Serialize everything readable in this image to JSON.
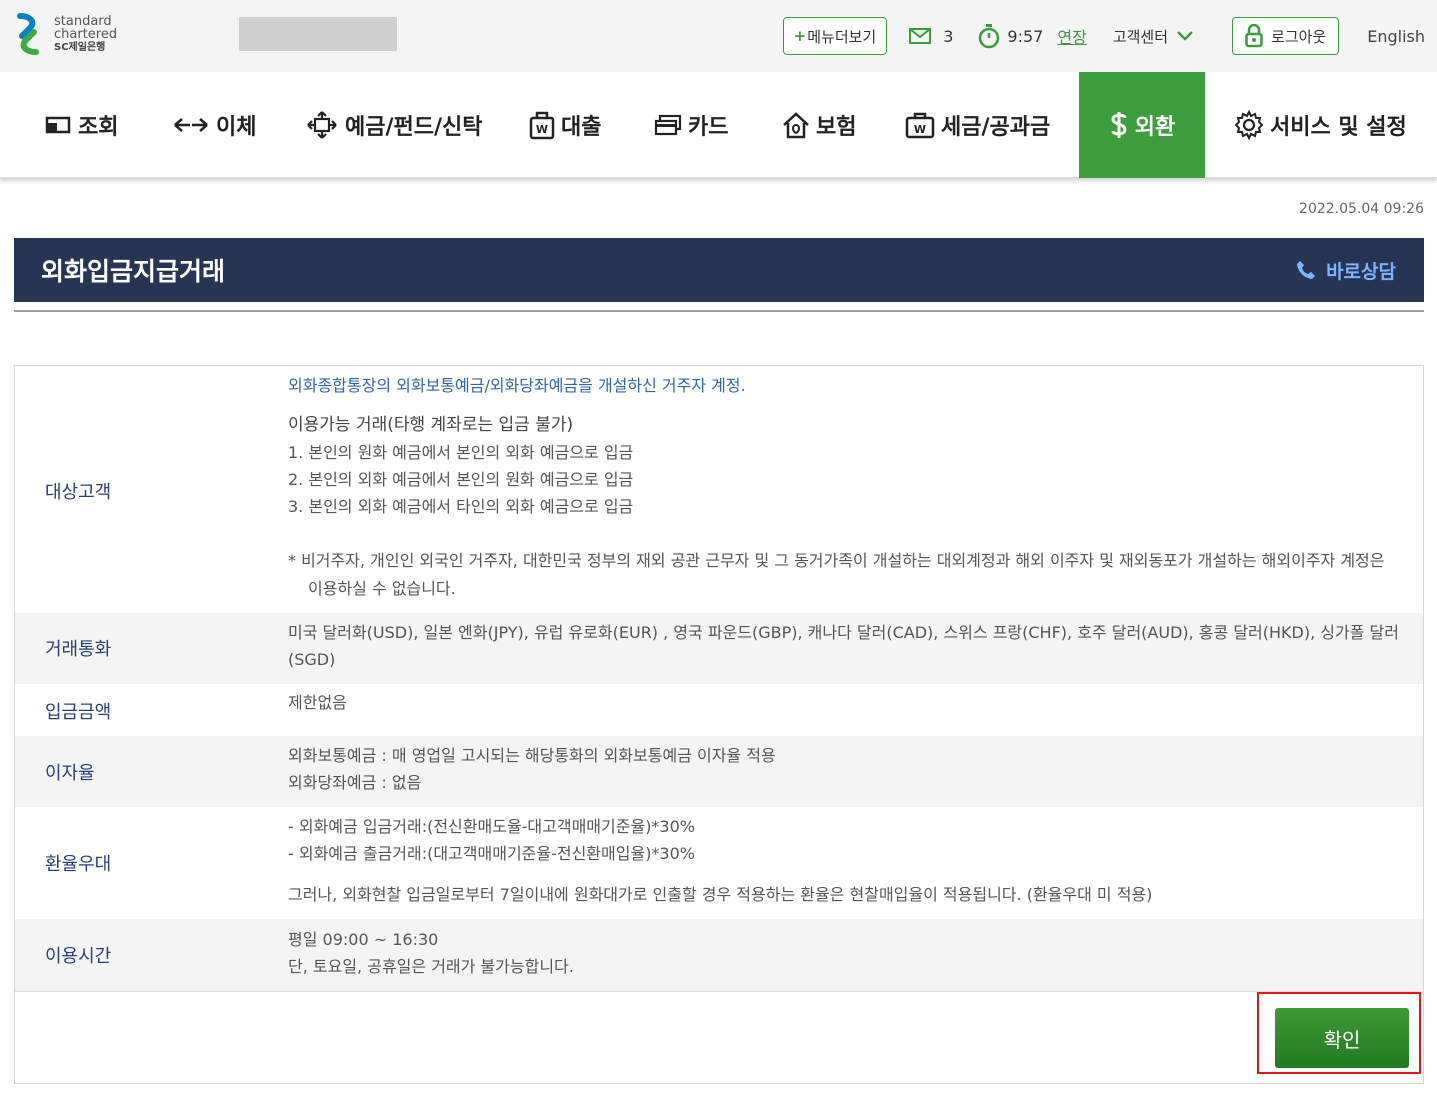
{
  "header": {
    "logo_line1": "standard",
    "logo_line2": "chartered",
    "logo_line3": "SC제일은행",
    "menu_plus": "+",
    "menu_label": "메뉴더보기",
    "mail_count": "3",
    "timer": "9:57",
    "extend_label": "연장",
    "customer_center": "고객센터",
    "logout_label": "로그아웃",
    "language": "English"
  },
  "nav": {
    "items": [
      {
        "label": "조회",
        "icon": "inquiry-icon"
      },
      {
        "label": "이체",
        "icon": "transfer-icon"
      },
      {
        "label": "예금/펀드/신탁",
        "icon": "deposit-icon"
      },
      {
        "label": "대출",
        "icon": "loan-icon"
      },
      {
        "label": "카드",
        "icon": "card-icon"
      },
      {
        "label": "보험",
        "icon": "insurance-icon"
      },
      {
        "label": "세금/공과금",
        "icon": "tax-icon"
      },
      {
        "label": "외환",
        "icon": "dollar-icon",
        "active": true
      },
      {
        "label": "서비스 및 설정",
        "icon": "gear-icon"
      }
    ]
  },
  "datetime": "2022.05.04 09:26",
  "page": {
    "title": "외화입금지급거래",
    "consult_label": "바로상담"
  },
  "info": {
    "target": {
      "label": "대상고객",
      "line1": "외화종합통장의 외화보통예금/외화당좌예금을 개설하신 거주자 계정.",
      "subtitle": "이용가능 거래(타행 계좌로는 입금 불가)",
      "item1": "1. 본인의 원화 예금에서 본인의 외화 예금으로 입금",
      "item2": "2. 본인의 외화 예금에서 본인의 원화 예금으로 입금",
      "item3": "3. 본인의 외화 예금에서 타인의 외화 예금으로 입금",
      "note": "* 비거주자, 개인인 외국인 거주자, 대한민국 정부의 재외 공관 근무자 및 그 동거가족이 개설하는 대외계정과 해외 이주자 및 재외동포가 개설하는 해외이주자 계정은 이용하실 수 없습니다."
    },
    "currency": {
      "label": "거래통화",
      "text": "미국 달러화(USD), 일본 엔화(JPY), 유럽 유로화(EUR) , 영국 파운드(GBP), 캐나다 달러(CAD), 스위스 프랑(CHF), 호주 달러(AUD), 홍콩 달러(HKD), 싱가폴 달러(SGD)"
    },
    "amount": {
      "label": "입금금액",
      "text": "제한없음"
    },
    "interest": {
      "label": "이자율",
      "line1": "외화보통예금 : 매 영업일 고시되는 해당통화의 외화보통예금 이자율 적용",
      "line2": "외화당좌예금 : 없음"
    },
    "fx": {
      "label": "환율우대",
      "line1": "- 외화예금 입금거래:(전신환매도율-대고객매매기준율)*30%",
      "line2": "- 외화예금 출금거래:(대고객매매기준율-전신환매입율)*30%",
      "line3": "그러나, 외화현찰 입금일로부터 7일이내에 원화대가로 인출할 경우 적용하는 환율은 현찰매입율이 적용됩니다. (환율우대 미 적용)"
    },
    "hours": {
      "label": "이용시간",
      "line1": "평일 09:00 ~ 16:30",
      "line2": "단, 토요일, 공휴일은 거래가 불가능합니다."
    }
  },
  "confirm_label": "확인",
  "colors": {
    "brand_green": "#3b9d3b",
    "title_navy": "#263554",
    "highlight_red": "#e01717"
  }
}
